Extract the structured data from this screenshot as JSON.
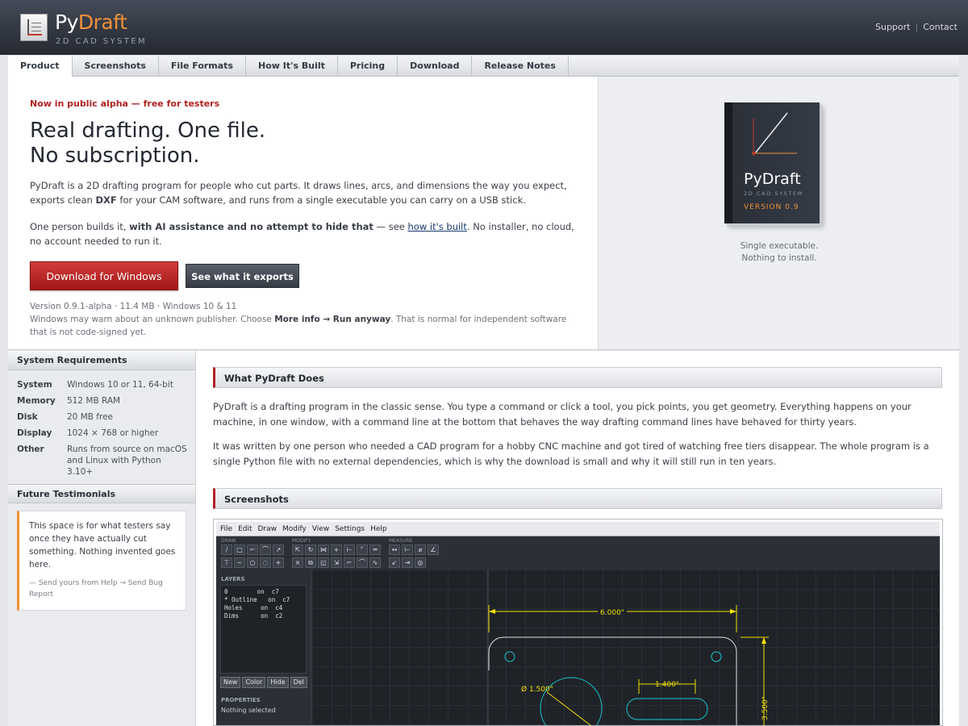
{
  "header": {
    "brand_main": "Py",
    "brand_accent": "Draft",
    "brand_sub": "2D CAD SYSTEM",
    "links": [
      "Support",
      "Contact"
    ]
  },
  "nav": [
    "Product",
    "Screenshots",
    "File Formats",
    "How It's Built",
    "Pricing",
    "Download",
    "Release Notes"
  ],
  "hero": {
    "tagline": "Now in public alpha — free for testers",
    "headline_1": "Real drafting. One file.",
    "headline_2": "No subscription.",
    "p1_a": "PyDraft is a 2D drafting program for people who cut parts. It draws lines, arcs, and dimensions the way you expect, exports clean ",
    "p1_b": "DXF",
    "p1_c": " for your CAM software, and runs from a single executable you can carry on a USB stick.",
    "p2_a": "One person builds it, ",
    "p2_b": "with AI assistance and no attempt to hide that",
    "p2_c": " — see ",
    "p2_link": "how it's built",
    "p2_d": ". No installer, no cloud, no account needed to run it.",
    "btn_primary": "Download for Windows",
    "btn_secondary": "See what it exports",
    "meta_1": "Version 0.9.1-alpha  ·  11.4 MB  ·  Windows 10 & 11",
    "meta_2a": "Windows may warn about an unknown publisher. Choose ",
    "meta_2b": "More info → Run anyway",
    "meta_2c": ". That is normal for independent software that is not code-signed yet."
  },
  "box": {
    "name": "PyDraft",
    "sub": "2D CAD SYSTEM",
    "version": "VERSION 0.9",
    "note_1": "Single executable.",
    "note_2": "Nothing to install."
  },
  "sidebar": {
    "req_title": "System Requirements",
    "requirements": [
      {
        "k": "System",
        "v": "Windows 10 or 11, 64-bit"
      },
      {
        "k": "Memory",
        "v": "512 MB RAM"
      },
      {
        "k": "Disk",
        "v": "20 MB free"
      },
      {
        "k": "Display",
        "v": "1024 × 768 or higher"
      },
      {
        "k": "Other",
        "v": "Runs from source on macOS and Linux with Python 3.10+"
      }
    ],
    "testi_title": "Future Testimonials",
    "testi_text": "This space is for what testers say once they have actually cut something. Nothing invented goes here.",
    "testi_sign": "— Send yours from Help → Send Bug Report"
  },
  "main": {
    "sec1": "What PyDraft Does",
    "p1": "PyDraft is a drafting program in the classic sense. You type a command or click a tool, you pick points, you get geometry. Everything happens on your machine, in one window, with a command line at the bottom that behaves the way drafting command lines have behaved for thirty years.",
    "p2": "It was written by one person who needed a CAD program for a hobby CNC machine and got tired of watching free tiers disappear. The whole program is a single Python file with no external dependencies, which is why the download is small and why it will still run in ten years.",
    "sec2": "Screenshots"
  },
  "app": {
    "menu": [
      "File",
      "Edit",
      "Draw",
      "Modify",
      "View",
      "Settings",
      "Help"
    ],
    "groups": [
      "DRAW",
      "MODIFY",
      "MEASURE"
    ],
    "layers_title": "LAYERS",
    "layers": [
      "0        on  c7",
      "* Outline   on  c7",
      "Holes     on  c4",
      "Dims      on  c2"
    ],
    "layer_buttons": [
      "New",
      "Color",
      "Hide",
      "Del"
    ],
    "props_title": "PROPERTIES",
    "props_value": "Nothing selected",
    "dim_width": "6.000\"",
    "dim_slot": "1.400\"",
    "dim_dia": "Ø 1.500\"",
    "dim_height": "3.500\"",
    "colors": {
      "dim": "#f2e200",
      "geom": "#dfe3e8",
      "holes": "#19c8d2",
      "accent": "#f0903a"
    }
  }
}
